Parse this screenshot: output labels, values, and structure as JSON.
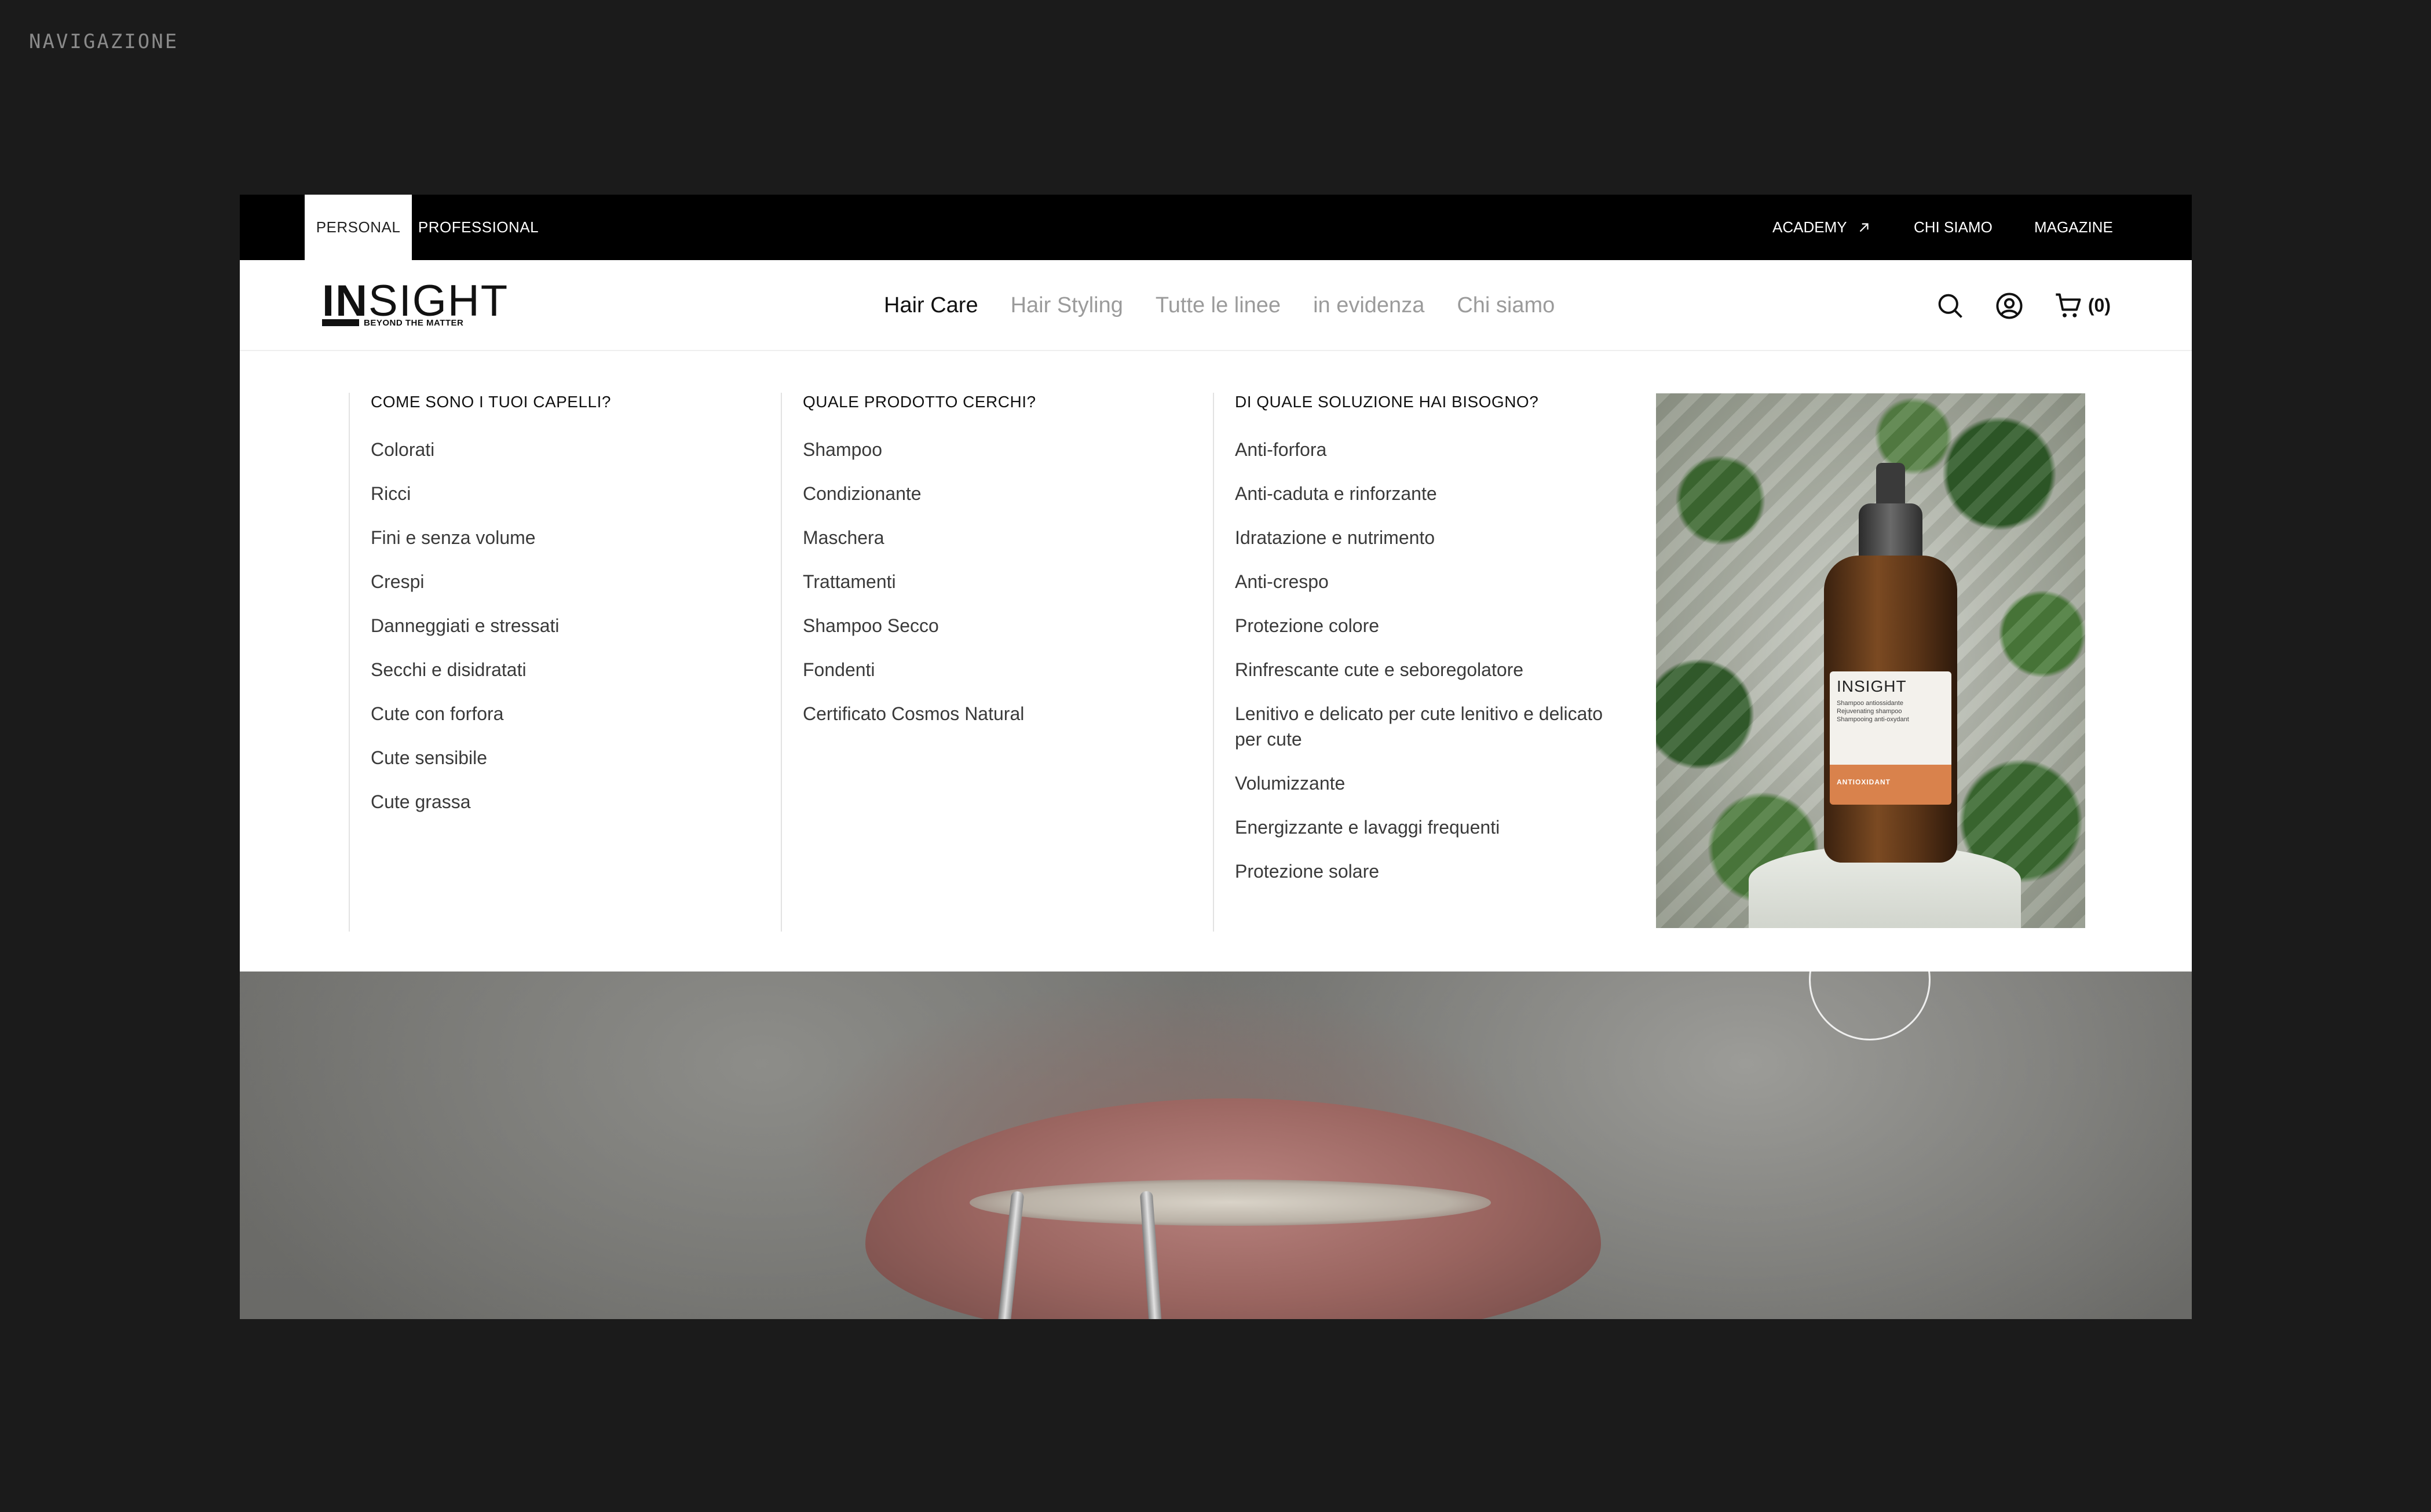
{
  "canvas_label": "NAVIGAZIONE",
  "topbar": {
    "tabs": [
      {
        "label": "PERSONAL",
        "active": true
      },
      {
        "label": "PROFESSIONAL",
        "active": false
      }
    ],
    "right_links": [
      "ACADEMY",
      "CHI SIAMO",
      "MAGAZINE"
    ]
  },
  "header": {
    "logo": {
      "word_bold": "IN",
      "word_light": "SIGHT",
      "tagline": "BEYOND THE MATTER"
    },
    "nav": [
      {
        "label": "Hair Care",
        "active": true
      },
      {
        "label": "Hair Styling",
        "active": false
      },
      {
        "label": "Tutte le linee",
        "active": false
      },
      {
        "label": "in evidenza",
        "active": false
      },
      {
        "label": "Chi siamo",
        "active": false
      }
    ],
    "cart_count": "(0)"
  },
  "mega_menu": {
    "columns": [
      {
        "title": "COME SONO I TUOI CAPELLI?",
        "items": [
          "Colorati",
          "Ricci",
          "Fini e senza volume",
          "Crespi",
          "Danneggiati e stressati",
          "Secchi e disidratati",
          "Cute con forfora",
          "Cute sensibile",
          "Cute grassa"
        ]
      },
      {
        "title": "QUALE PRODOTTO CERCHI?",
        "items": [
          "Shampoo",
          "Condizionante",
          "Maschera",
          "Trattamenti",
          "Shampoo Secco",
          "Fondenti",
          "Certificato Cosmos Natural"
        ]
      },
      {
        "title": "DI QUALE SOLUZIONE HAI BISOGNO?",
        "items": [
          "Anti-forfora",
          "Anti-caduta e rinforzante",
          "Idratazione e nutrimento",
          "Anti-crespo",
          "Protezione colore",
          "Rinfrescante cute e seboregolatore",
          "Lenitivo e delicato per cute lenitivo e delicato per cute",
          "Volumizzante",
          "Energizzante e lavaggi frequenti",
          "Protezione solare"
        ]
      }
    ],
    "promo_bottle": {
      "brand": "INSIGHT",
      "text": "Shampoo antiossidante\nRejuvenating shampoo\nShampooing anti-oxydant",
      "line": "ANTIOXIDANT"
    }
  },
  "colors": {
    "topbar_bg": "#000000",
    "page_bg": "#1b1b1b",
    "nav_active": "#111111",
    "nav_inactive": "#9b9b9b"
  }
}
